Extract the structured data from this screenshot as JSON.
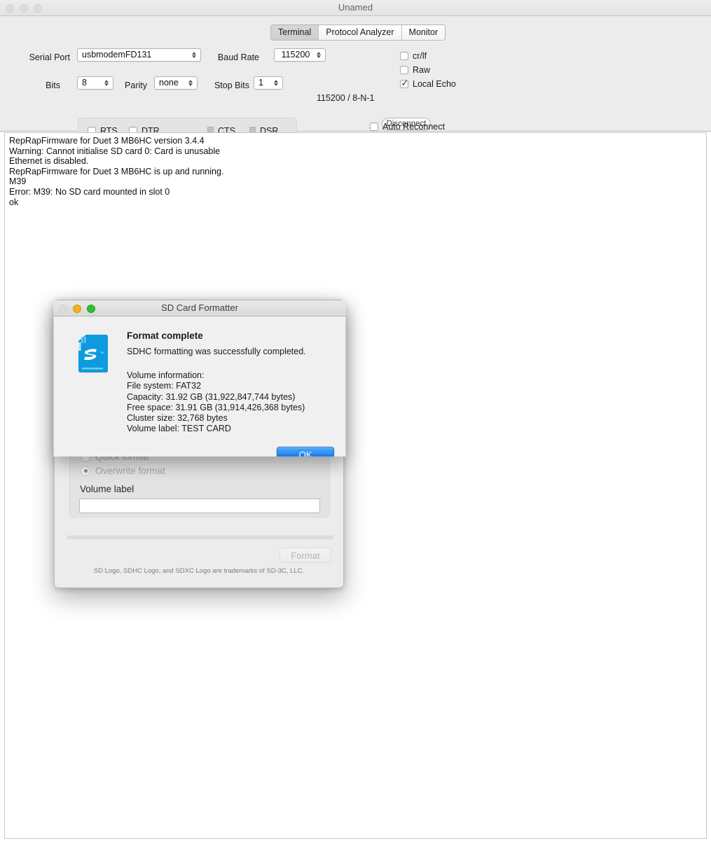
{
  "main_window": {
    "title": "Unamed",
    "traffic_lights": [
      "close-button",
      "minimize-button",
      "zoom-button"
    ],
    "tabs": [
      {
        "label": "Terminal",
        "selected": true
      },
      {
        "label": "Protocol Analyzer",
        "selected": false
      },
      {
        "label": "Monitor",
        "selected": false
      }
    ],
    "fields": {
      "serial_port_label": "Serial Port",
      "serial_port_value": "usbmodemFD131",
      "baud_rate_label": "Baud Rate",
      "baud_rate_value": "115200",
      "bits_label": "Bits",
      "bits_value": "8",
      "parity_label": "Parity",
      "parity_value": "none",
      "stop_bits_label": "Stop Bits",
      "stop_bits_value": "1",
      "line_status": "115200 / 8-N-1"
    },
    "options": [
      {
        "label": "cr/lf",
        "checked": false
      },
      {
        "label": "Raw",
        "checked": false
      },
      {
        "label": "Local Echo",
        "checked": true
      }
    ],
    "flow_control": [
      {
        "label": "RTS",
        "type": "checkbox",
        "checked": false
      },
      {
        "label": "DTR",
        "type": "checkbox",
        "checked": false
      },
      {
        "label": "CTS",
        "type": "led",
        "on": false
      },
      {
        "label": "DSR",
        "type": "led",
        "on": false
      }
    ],
    "disconnect_label": "Disconnect",
    "auto_reconnect": {
      "label": "Auto Reconnect",
      "checked": false
    },
    "terminal_lines": [
      "RepRapFirmware for Duet 3 MB6HC version 3.4.4",
      "Warning: Cannot initialise SD card 0: Card is unusable",
      "Ethernet is disabled.",
      "RepRapFirmware for Duet 3 MB6HC is up and running.",
      "M39",
      "Error: M39: No SD card mounted in slot 0",
      "ok"
    ]
  },
  "sd_formatter_window": {
    "title": "SD Card Formatter",
    "format_options": [
      {
        "label": "Quick format",
        "selected": false
      },
      {
        "label": "Overwrite format",
        "selected": true
      }
    ],
    "volume_label_title": "Volume label",
    "volume_label_value": "",
    "volume_label_placeholder": "",
    "format_button": "Format",
    "trademark": "SD Logo, SDHC Logo, and SDXC Logo are trademarks of SD-3C, LLC."
  },
  "dialog": {
    "title": "SD Card Formatter",
    "traffic_lights": [
      "close-button-disabled",
      "minimize-button",
      "zoom-button"
    ],
    "heading": "Format complete",
    "subtitle": "SDHC formatting was successfully completed.",
    "info_lines": [
      "Volume information:",
      "File system: FAT32",
      "Capacity: 31.92 GB (31,922,847,744 bytes)",
      "Free space: 31.91 GB (31,914,426,368 bytes)",
      "Cluster size: 32,768 bytes",
      "Volume label: TEST CARD"
    ],
    "ok_label": "OK",
    "icon": "sd-card-icon"
  },
  "colors": {
    "accent_blue": "#2b8cf4",
    "sd_card_blue": "#0e9ade",
    "window_chrome": "#ececec",
    "traffic_yellow": "#f6b024",
    "traffic_green": "#2ac22e"
  }
}
